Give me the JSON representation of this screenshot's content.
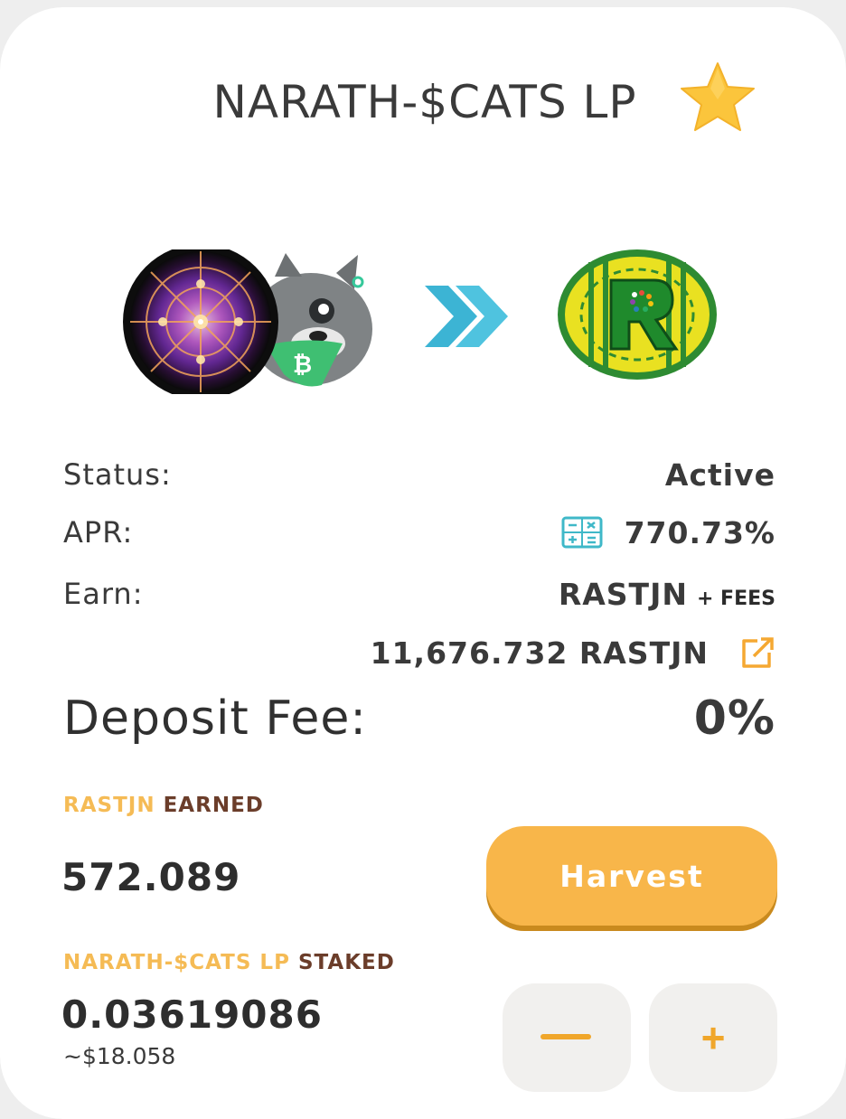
{
  "pool": {
    "title": "NARATH-$CATS LP",
    "favorite_icon": "star-icon",
    "token_logos": [
      "narath-cat-logo",
      "rastjn-logo"
    ],
    "arrow_icon": "double-chevron-right-icon"
  },
  "details": {
    "status_label": "Status:",
    "status_value": "Active",
    "apr_label": "APR:",
    "apr_value": "770.73%",
    "earn_label": "Earn:",
    "earn_token": "RASTJN",
    "earn_suffix": "+ FEES",
    "amount_value": "11,676.732 RASTJN",
    "deposit_fee_label": "Deposit Fee:",
    "deposit_fee_value": "0%"
  },
  "earned": {
    "label_token": "RASTJN",
    "label_suffix": "EARNED",
    "value": "572.089",
    "harvest_label": "Harvest"
  },
  "staked": {
    "label_token": "NARATH-$CATS LP",
    "label_suffix": "STAKED",
    "value": "0.03619086",
    "usd_value": "~$18.058",
    "plus_label": "+"
  },
  "colors": {
    "accent": "#f8b64a",
    "brown": "#6b3d2a",
    "calculator": "#3fb8c8",
    "arrow": "#3cb4d4"
  }
}
